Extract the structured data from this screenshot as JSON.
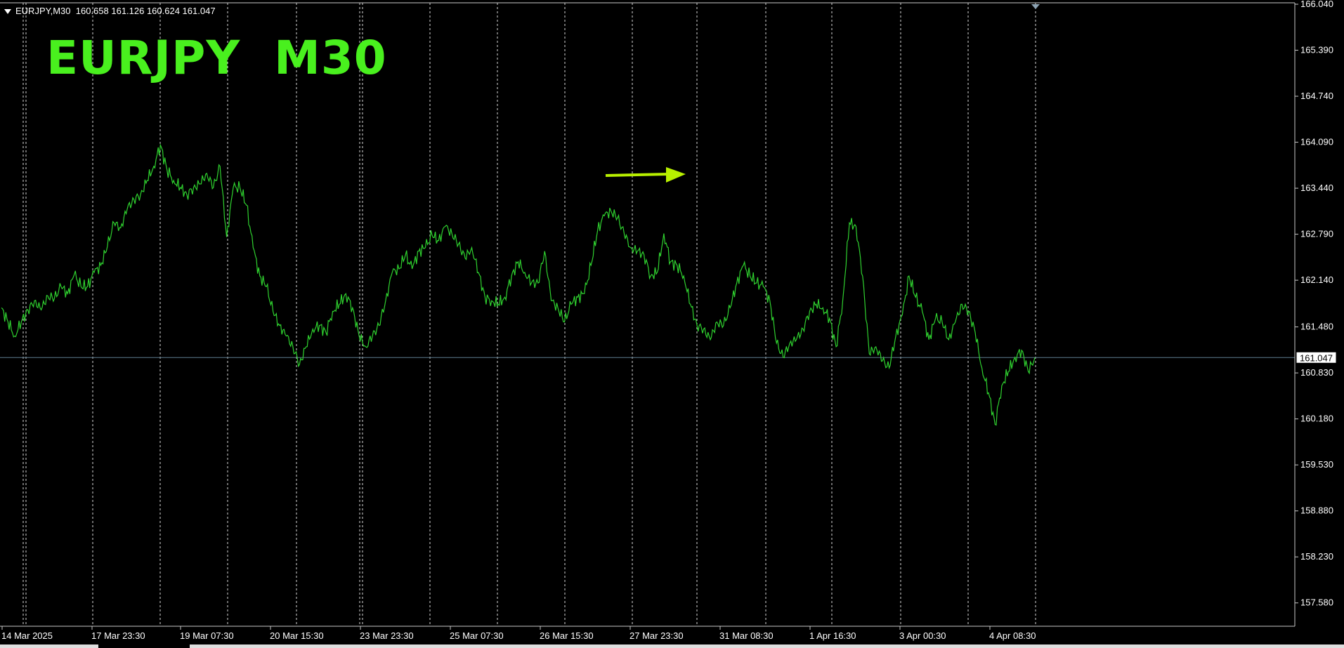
{
  "header": {
    "symbol": "EURJPY,M30",
    "ohlc": "160.658 161.126 160.624 161.047"
  },
  "overlay_label": "EURJPY  M30",
  "annotation": {
    "type": "arrow",
    "color": "#b8f000"
  },
  "colors": {
    "background": "#000000",
    "series": "#2fd12f",
    "grid": "#ffffff",
    "axis": "#c8c8c8",
    "text": "#ffffff",
    "label": "#49f01e",
    "price_line": "#5f7d8f"
  },
  "chart_data": {
    "type": "line",
    "title": "",
    "xlabel": "",
    "ylabel": "",
    "ylim": [
      157.25,
      166.06
    ],
    "y_ticks": [
      "166.040",
      "165.390",
      "164.740",
      "164.090",
      "163.440",
      "162.790",
      "162.140",
      "161.480",
      "160.830",
      "160.180",
      "159.530",
      "158.880",
      "158.230",
      "157.580"
    ],
    "x_ticks": [
      "14 Mar 2025",
      "17 Mar 23:30",
      "19 Mar 07:30",
      "20 Mar 15:30",
      "23 Mar 23:30",
      "25 Mar 07:30",
      "26 Mar 15:30",
      "27 Mar 23:30",
      "31 Mar 08:30",
      "1 Apr 16:30",
      "3 Apr 00:30",
      "4 Apr 08:30"
    ],
    "current_price": "161.047",
    "grid": "vertical dotted",
    "series": [
      {
        "values": [
          161.75,
          161.55,
          161.35,
          161.55,
          161.72,
          161.85,
          161.72,
          161.92,
          161.88,
          162.05,
          161.95,
          162.22,
          162.05,
          162.05,
          162.25,
          162.35,
          162.62,
          162.95,
          162.88,
          163.15,
          163.28,
          163.35,
          163.55,
          163.75,
          164.05,
          163.7,
          163.55,
          163.45,
          163.35,
          163.45,
          163.5,
          163.65,
          163.45,
          163.75,
          162.75,
          163.45,
          163.45,
          163.2,
          162.6,
          162.2,
          162.05,
          161.7,
          161.5,
          161.35,
          161.2,
          160.95,
          161.2,
          161.45,
          161.5,
          161.4,
          161.7,
          161.8,
          161.95,
          161.75,
          161.35,
          161.2,
          161.35,
          161.5,
          161.85,
          162.25,
          162.3,
          162.5,
          162.3,
          162.55,
          162.6,
          162.78,
          162.7,
          162.9,
          162.8,
          162.65,
          162.45,
          162.6,
          162.25,
          161.9,
          161.85,
          161.8,
          161.9,
          162.2,
          162.4,
          162.25,
          162.1,
          162.1,
          162.55,
          161.85,
          161.75,
          161.55,
          161.8,
          161.9,
          161.95,
          162.35,
          162.85,
          163.05,
          163.12,
          163.02,
          162.8,
          162.6,
          162.55,
          162.5,
          162.2,
          162.25,
          162.8,
          162.4,
          162.35,
          162.2,
          161.8,
          161.5,
          161.45,
          161.3,
          161.55,
          161.5,
          161.75,
          162.1,
          162.35,
          162.2,
          162.1,
          162.05,
          161.85,
          161.25,
          161.05,
          161.25,
          161.3,
          161.45,
          161.7,
          161.8,
          161.75,
          161.6,
          161.2,
          161.85,
          162.95,
          162.9,
          162.2,
          161.1,
          161.2,
          161.0,
          160.9,
          161.35,
          161.65,
          162.2,
          161.9,
          161.7,
          161.3,
          161.6,
          161.55,
          161.3,
          161.55,
          161.8,
          161.7,
          161.4,
          160.9,
          160.55,
          160.1,
          160.65,
          160.85,
          161.05,
          161.15,
          160.85,
          161.047
        ]
      }
    ]
  }
}
